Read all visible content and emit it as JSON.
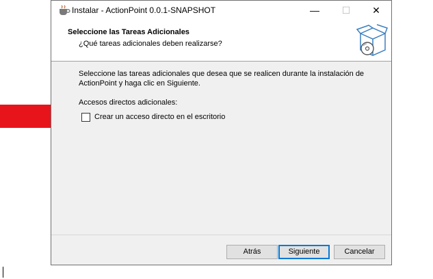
{
  "window": {
    "title": "Instalar - ActionPoint 0.0.1-SNAPSHOT",
    "controls": {
      "minimize": "—",
      "maximize": "☐",
      "close": "✕"
    }
  },
  "header": {
    "title": "Seleccione las Tareas Adicionales",
    "subtitle": "¿Qué tareas adicionales deben realizarse?",
    "icon": "setup-box-disc-icon"
  },
  "content": {
    "description": "Seleccione las tareas adicionales que desea que se realicen durante la instalación de ActionPoint y haga clic en Siguiente.",
    "group_label": "Accesos directos adicionales:",
    "checkbox": {
      "label": "Crear un acceso directo en el escritorio",
      "checked": false
    }
  },
  "buttons": {
    "back": "Atrás",
    "next": "Siguiente",
    "cancel": "Cancelar"
  },
  "annotation": {
    "icon": "red-arrow-icon",
    "color": "#e8141b"
  }
}
